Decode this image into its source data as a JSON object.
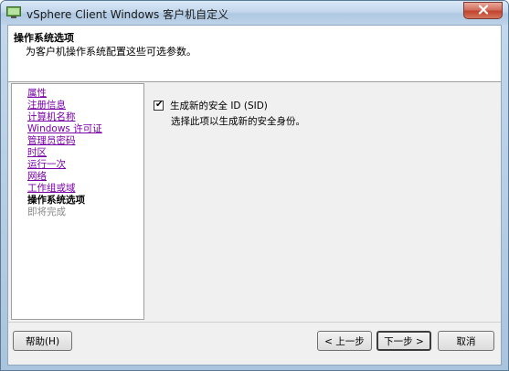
{
  "window": {
    "title": "vSphere Client Windows 客户机自定义"
  },
  "header": {
    "title": "操作系统选项",
    "subtitle": "为客户机操作系统配置这些可选参数。"
  },
  "nav": {
    "items": [
      {
        "label": "属性",
        "state": "link"
      },
      {
        "label": "注册信息",
        "state": "link"
      },
      {
        "label": "计算机名称",
        "state": "link"
      },
      {
        "label": "Windows 许可证",
        "state": "link"
      },
      {
        "label": "管理员密码",
        "state": "link"
      },
      {
        "label": "时区",
        "state": "link"
      },
      {
        "label": "运行一次",
        "state": "link"
      },
      {
        "label": "网络",
        "state": "link"
      },
      {
        "label": "工作组或域",
        "state": "link"
      },
      {
        "label": "操作系统选项",
        "state": "current"
      },
      {
        "label": "即将完成",
        "state": "disabled"
      }
    ]
  },
  "content": {
    "sid_checkbox_label": "生成新的安全 ID (SID)",
    "sid_checked": true,
    "sid_description": "选择此项以生成新的安全身份。"
  },
  "buttons": {
    "help": "帮助(H)",
    "back": "< 上一步",
    "next": "下一步 >",
    "cancel": "取消"
  },
  "colors": {
    "link": "#7a00a8",
    "close_button": "#c2442d"
  }
}
